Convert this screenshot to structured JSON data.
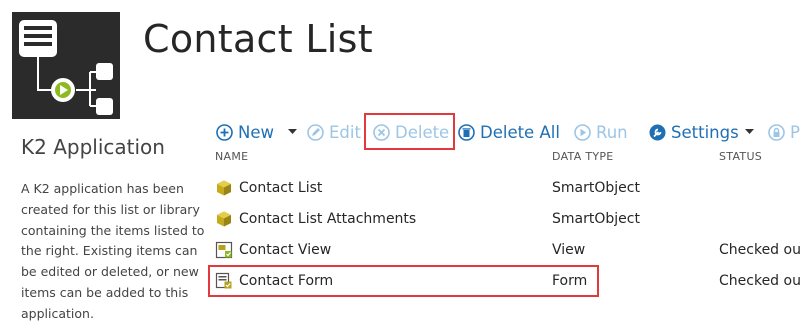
{
  "app": {
    "icon": "k2-app-workflow-icon",
    "title": "Contact List"
  },
  "side": {
    "heading": "K2 Application",
    "description": "A K2 application has been created for this list or library containing the items listed to the right. Existing items can be edited or deleted, or new items can be added to this application."
  },
  "toolbar": {
    "new_label": "New",
    "edit_label": "Edit",
    "delete_label": "Delete",
    "delete_all_label": "Delete All",
    "run_label": "Run",
    "settings_label": "Settings",
    "overflow_label": "P"
  },
  "columns": {
    "name": "NAME",
    "data_type": "DATA TYPE",
    "status": "STATUS"
  },
  "rows": [
    {
      "name": "Contact List",
      "type": "SmartObject",
      "status": "",
      "icon": "smartobject-cube-icon"
    },
    {
      "name": "Contact List Attachments",
      "type": "SmartObject",
      "status": "",
      "icon": "smartobject-cube-icon"
    },
    {
      "name": "Contact View",
      "type": "View",
      "status": "Checked out",
      "icon": "view-icon"
    },
    {
      "name": "Contact Form",
      "type": "Form",
      "status": "Checked out",
      "icon": "form-icon"
    }
  ],
  "colors": {
    "accent": "#1f6fb5",
    "accent_disabled": "#9cc5e6",
    "highlight": "#e0393e",
    "tile_bg": "#2b2b2b",
    "smartobject": "#b7a11f",
    "workflow_green": "#8dbb1f"
  }
}
